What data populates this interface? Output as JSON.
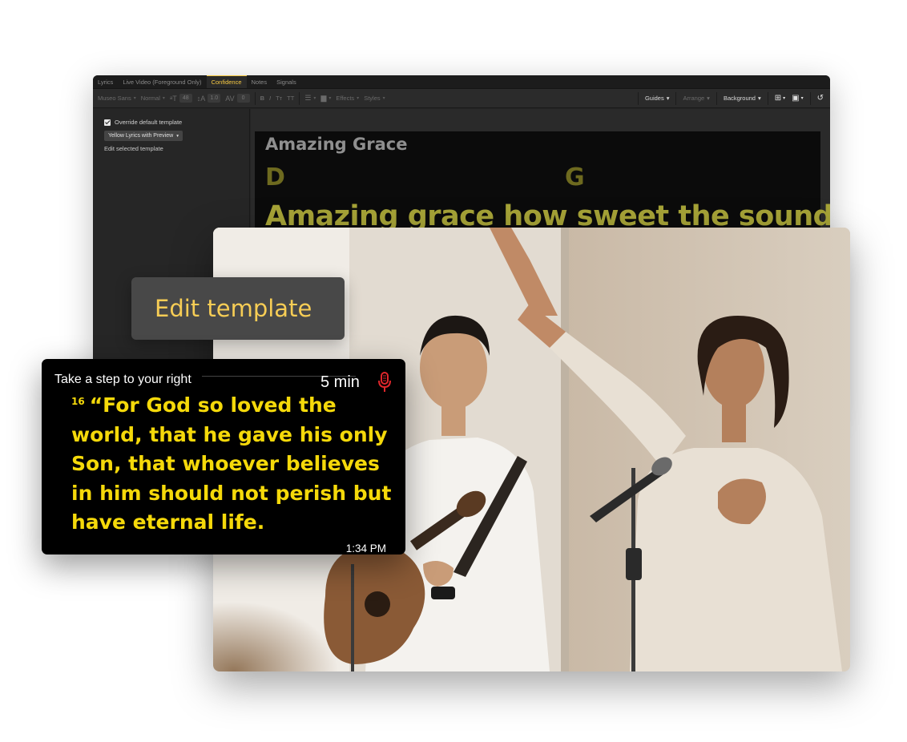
{
  "app": {
    "tabs": [
      {
        "label": "Lyrics",
        "active": false
      },
      {
        "label": "Live Video (Foreground Only)",
        "active": false
      },
      {
        "label": "Confidence",
        "active": true
      },
      {
        "label": "Notes",
        "active": false
      },
      {
        "label": "Signals",
        "active": false
      }
    ],
    "toolbar": {
      "font_family": "Museo Sans",
      "font_weight": "Normal",
      "font_size_icon": "font-size-icon",
      "font_size_value": "48",
      "line_height_icon": "line-height-icon",
      "line_height_value": "1.0",
      "tracking_icon": "letter-spacing-icon",
      "tracking_value": "0",
      "bold": "B",
      "italic": "I",
      "smallcaps": "Tт",
      "allcaps": "TT",
      "align_icon": "align-icon",
      "fill_icon": "fill-icon",
      "effects": "Effects",
      "styles": "Styles",
      "guides": "Guides",
      "arrange": "Arrange",
      "background": "Background",
      "text_box_icon": "text-box-icon",
      "image_icon": "image-icon",
      "reset_icon": "reset-icon"
    },
    "left_panel": {
      "override_label": "Override default template",
      "override_checked": true,
      "template_selected": "Yellow Lyrics with Preview",
      "edit_selected_label": "Edit selected template"
    },
    "slide": {
      "title": "Amazing Grace",
      "chords": [
        "D",
        "G"
      ],
      "lyric": "Amazing grace how sweet the sound"
    }
  },
  "edit_template_button": {
    "label": "Edit template"
  },
  "confidence_monitor": {
    "stage_note": "Take a step to your right",
    "timer": "5 min",
    "mic_icon": "microphone-icon",
    "verse_number": "16",
    "scripture": "“For God so loved the world, that he gave his only Son, that whoever believes in him should not perish but have eternal life.",
    "clock": "1:34 PM"
  },
  "colors": {
    "accent_tab": "#f5c842",
    "pill_text": "#f7cd55",
    "scripture_yellow": "#f5d90a",
    "mic_red": "#e0262b"
  }
}
